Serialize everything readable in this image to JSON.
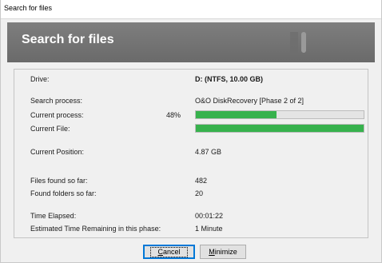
{
  "window": {
    "title": "Search for files"
  },
  "banner": {
    "heading": "Search for files"
  },
  "info": {
    "drive_label": "Drive:",
    "drive_value": "D: (NTFS, 10.00 GB)",
    "search_process_label": "Search process:",
    "search_process_value": "O&O DiskRecovery [Phase 2 of 2]",
    "current_process_label": "Current process:",
    "current_process_percent_text": "48%",
    "current_process_progress": 0.48,
    "current_file_label": "Current File:",
    "current_file_progress": 1.0,
    "current_position_label": "Current Position:",
    "current_position_value": "4.87 GB",
    "files_found_label": "Files found so far:",
    "files_found_value": "482",
    "folders_found_label": "Found folders so far:",
    "folders_found_value": "20",
    "time_elapsed_label": "Time Elapsed:",
    "time_elapsed_value": "00:01:22",
    "time_remaining_label": "Estimated Time Remaining in this phase:",
    "time_remaining_value": "1 Minute"
  },
  "buttons": {
    "cancel_hotkey": "C",
    "cancel_rest": "ancel",
    "minimize_hotkey": "M",
    "minimize_rest": "inimize"
  },
  "colors": {
    "progress_fill": "#37b24d",
    "banner_bg": "#747474",
    "focus_border": "#0078d7"
  }
}
